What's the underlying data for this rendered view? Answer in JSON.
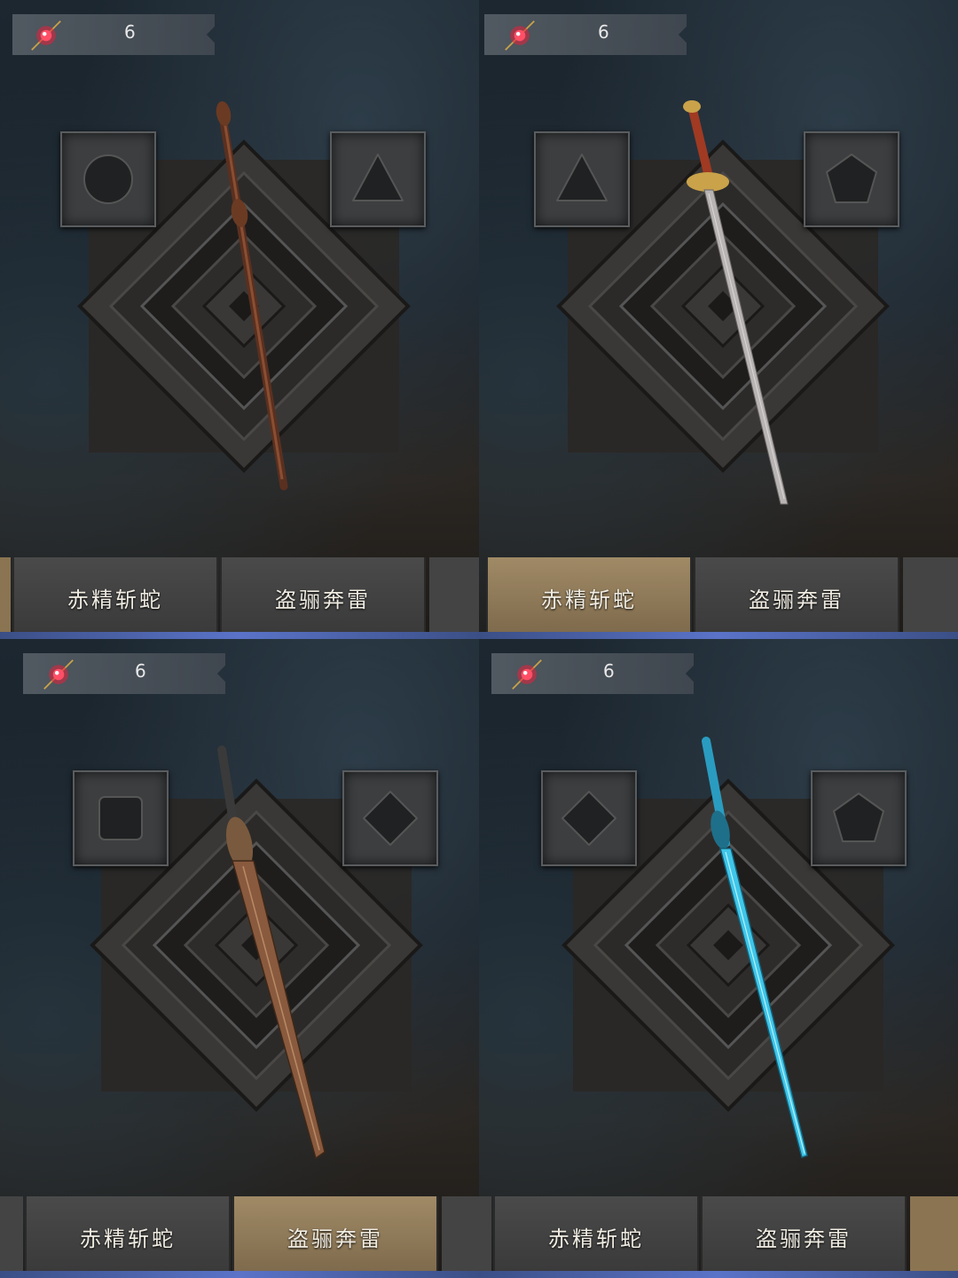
{
  "panels": [
    {
      "resource": {
        "icon": "red-crystal-icon",
        "count": "6"
      },
      "slots": [
        {
          "shape": "circle"
        },
        {
          "shape": "triangle"
        }
      ],
      "weapon": {
        "kind": "brown-staff",
        "color": "#6b3a22"
      },
      "tabs": [
        {
          "label": "赤精斩蛇",
          "active": false
        },
        {
          "label": "盗骊奔雷",
          "active": false
        }
      ]
    },
    {
      "resource": {
        "icon": "red-crystal-icon",
        "count": "6"
      },
      "slots": [
        {
          "shape": "triangle"
        },
        {
          "shape": "pentagon"
        }
      ],
      "weapon": {
        "kind": "silver-sword",
        "color": "#b8b4b4"
      },
      "tabs": [
        {
          "label": "赤精斩蛇",
          "active": true
        },
        {
          "label": "盗骊奔雷",
          "active": false
        }
      ]
    },
    {
      "resource": {
        "icon": "red-crystal-icon",
        "count": "6"
      },
      "slots": [
        {
          "shape": "square"
        },
        {
          "shape": "diamond"
        }
      ],
      "weapon": {
        "kind": "bronze-sword",
        "color": "#8a5a3e"
      },
      "tabs": [
        {
          "label": "赤精斩蛇",
          "active": false
        },
        {
          "label": "盗骊奔雷",
          "active": true
        }
      ]
    },
    {
      "resource": {
        "icon": "red-crystal-icon",
        "count": "6"
      },
      "slots": [
        {
          "shape": "diamond"
        },
        {
          "shape": "pentagon"
        }
      ],
      "weapon": {
        "kind": "azure-sword",
        "color": "#3fc6e8"
      },
      "tabs": [
        {
          "label": "赤精斩蛇",
          "active": false
        },
        {
          "label": "盗骊奔雷",
          "active": false
        }
      ]
    }
  ],
  "colors": {
    "accent_tab": "#a08a66",
    "tab_underline": "#5a73c8",
    "gem": "#e8203a"
  }
}
